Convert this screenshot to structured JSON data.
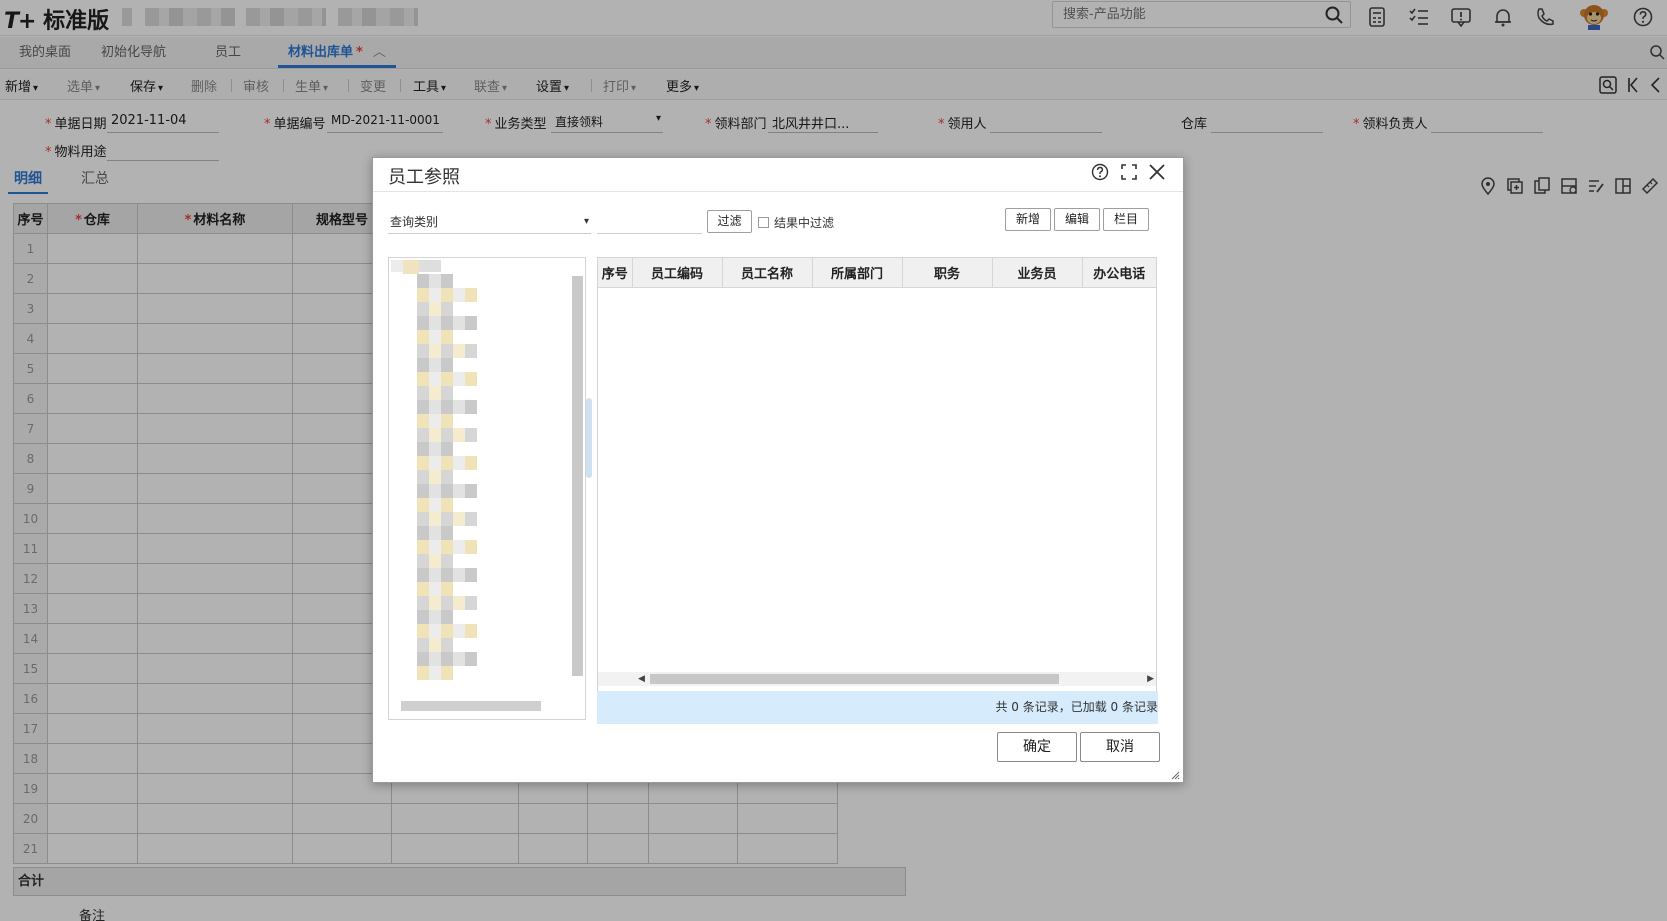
{
  "app": {
    "logo_prefix": "T+",
    "logo_text": "标准版"
  },
  "search": {
    "placeholder": "搜索-产品功能"
  },
  "tabs": [
    {
      "label": "我的桌面"
    },
    {
      "label": "初始化导航"
    },
    {
      "label": "员工"
    },
    {
      "label": "材料出库单",
      "dirty": "*",
      "active": true
    }
  ],
  "toolbar": {
    "items": [
      "新增",
      "选单",
      "保存",
      "删除",
      "审核",
      "生单",
      "变更",
      "工具",
      "联查",
      "设置",
      "打印",
      "更多"
    ]
  },
  "form": {
    "date_label": "单据日期",
    "date_value": "2021-11-04",
    "code_label": "单据编号",
    "code_value": "MD-2021-11-0001",
    "biz_label": "业务类型",
    "biz_value": "直接领料",
    "dept_label": "领料部门",
    "dept_value": "北风井井口...",
    "user_label": "领用人",
    "user_value": "",
    "wh_label": "仓库",
    "wh_value": "",
    "owner_label": "领料负责人",
    "owner_value": "",
    "purpose_label": "物料用途",
    "purpose_value": ""
  },
  "subtabs": {
    "detail": "明细",
    "summary": "汇总"
  },
  "grid": {
    "headers": {
      "idx": "序号",
      "warehouse": "仓库",
      "material": "材料名称",
      "spec": "规格型号"
    },
    "rows": [
      "1",
      "2",
      "3",
      "4",
      "5",
      "6",
      "7",
      "8",
      "9",
      "10",
      "11",
      "12",
      "13",
      "14",
      "15",
      "16",
      "17",
      "18",
      "19",
      "20",
      "21"
    ],
    "total_label": "合计",
    "remark_label": "备注"
  },
  "dialog": {
    "title": "员工参照",
    "query_type": "查询类别",
    "filter_btn": "过滤",
    "filter_in_result": "结果中过滤",
    "add_btn": "新增",
    "edit_btn": "编辑",
    "columns_btn": "栏目",
    "columns": [
      "序号",
      "员工编码",
      "员工名称",
      "所属部门",
      "职务",
      "业务员",
      "办公电话"
    ],
    "status": "共 0 条记录，已加载 0 条记录",
    "ok_btn": "确定",
    "cancel_btn": "取消"
  }
}
